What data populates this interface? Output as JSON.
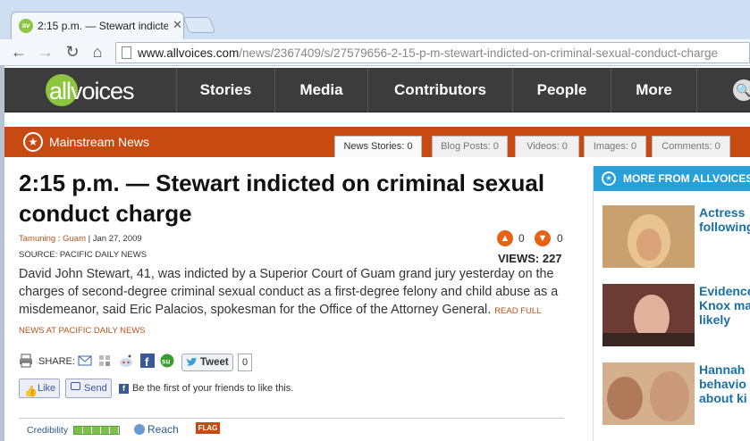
{
  "browser": {
    "tab_title": "2:15 p.m. — Stewart indicte",
    "tab_favicon": "av",
    "url_domain": "www.allvoices.com",
    "url_path": "/news/2367409/s/27579656-2-15-p-m-stewart-indicted-on-criminal-sexual-conduct-charge"
  },
  "site": {
    "logo_text_left": "all",
    "logo_text_right": "voices",
    "nav": [
      "Stories",
      "Media",
      "Contributors",
      "People",
      "More"
    ]
  },
  "section": {
    "label": "Mainstream News",
    "tabs": [
      "News Stories: 0",
      "Blog Posts: 0",
      "Videos: 0",
      "Images: 0",
      "Comments: 0"
    ]
  },
  "article": {
    "headline": "2:15 p.m. — Stewart indicted on criminal sexual conduct charge",
    "location": "Tamuning : Guam",
    "date": "| Jan 27, 2009",
    "source": "SOURCE: PACIFIC DAILY NEWS",
    "upvotes": "0",
    "downvotes": "0",
    "views": "VIEWS: 227",
    "body": "David John Stewart, 41, was indicted by a Superior Court of Guam grand jury yesterday on the charges of second-degree criminal sexual conduct as a first-degree felony and child abuse as a misdemeanor, said Eric Palacios, spokesman for the Office of the Attorney General.",
    "read_more": "READ FULL NEWS AT PACIFIC DAILY NEWS"
  },
  "share": {
    "label": "SHARE:",
    "tweet_label": "Tweet",
    "tweet_count": "0",
    "like_label": "Like",
    "send_label": "Send",
    "fb_text": "Be the first of your friends to like this."
  },
  "footer": {
    "credibility_label": "Credibility",
    "credibility_level": 5,
    "reach_label": "Reach",
    "flag_label": "FLAG"
  },
  "sidebar": {
    "title": "MORE FROM ALLVOICES",
    "items": [
      {
        "caption": "Actress following"
      },
      {
        "caption": "Evidence Knox ma likely"
      },
      {
        "caption": "Hannah behavio about ki"
      }
    ]
  }
}
